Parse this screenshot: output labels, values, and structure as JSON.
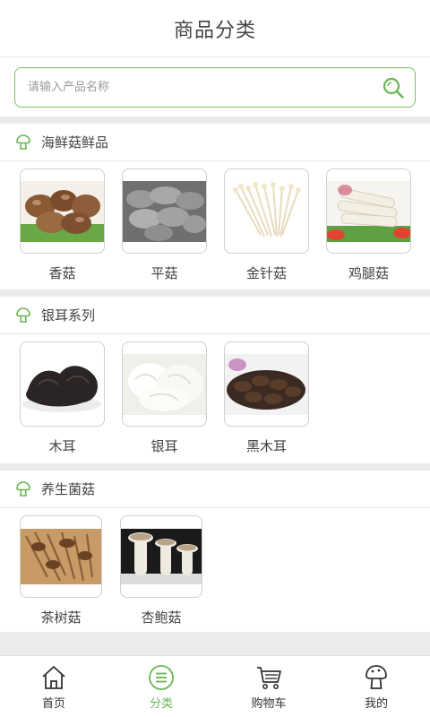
{
  "header": {
    "title": "商品分类"
  },
  "search": {
    "placeholder": "请输入产品名称",
    "icon": "search-icon"
  },
  "sections": [
    {
      "title": "海鲜菇鲜品",
      "icon": "mushroom-icon",
      "items": [
        {
          "name": "香菇",
          "image": "shiitake-mushrooms-image"
        },
        {
          "name": "平菇",
          "image": "oyster-mushrooms-image"
        },
        {
          "name": "金针菇",
          "image": "enoki-mushrooms-image"
        },
        {
          "name": "鸡腿菇",
          "image": "shaggy-mane-mushrooms-image"
        }
      ]
    },
    {
      "title": "银耳系列",
      "icon": "mushroom-icon",
      "items": [
        {
          "name": "木耳",
          "image": "wood-ear-image"
        },
        {
          "name": "银耳",
          "image": "white-fungus-image"
        },
        {
          "name": "黑木耳",
          "image": "black-fungus-image"
        }
      ]
    },
    {
      "title": "养生菌菇",
      "icon": "mushroom-icon",
      "items": [
        {
          "name": "茶树菇",
          "image": "tea-tree-mushroom-image"
        },
        {
          "name": "杏鲍菇",
          "image": "king-oyster-mushroom-image"
        }
      ]
    }
  ],
  "tabbar": {
    "active_color": "#6bb556",
    "tabs": [
      {
        "label": "首页",
        "icon": "home-icon",
        "active": false
      },
      {
        "label": "分类",
        "icon": "category-list-icon",
        "active": true
      },
      {
        "label": "购物车",
        "icon": "cart-icon",
        "active": false
      },
      {
        "label": "我的",
        "icon": "profile-mushroom-icon",
        "active": false
      }
    ]
  }
}
